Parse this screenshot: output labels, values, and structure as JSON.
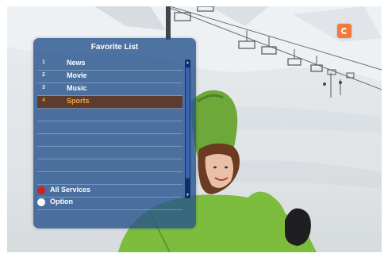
{
  "panel": {
    "title": "Favorite List",
    "items": [
      {
        "number": "1",
        "label": "News"
      },
      {
        "number": "2",
        "label": "Movie"
      },
      {
        "number": "3",
        "label": "Music"
      },
      {
        "number": "4",
        "label": "Sports",
        "selected": true
      }
    ]
  },
  "legend": [
    {
      "label": "All Services",
      "color": "#d21f1f"
    },
    {
      "label": "Option",
      "color": "#ffffff"
    }
  ],
  "colors": {
    "panel_bg": "#26528c",
    "selected_row": "#5b3c2f",
    "selected_text": "#f3a33a",
    "channel_logo": "#f27a3a"
  },
  "icons": {
    "channel_logo": "channel-logo-icon",
    "legend_red": "red-button-icon",
    "legend_white": "white-button-icon"
  }
}
